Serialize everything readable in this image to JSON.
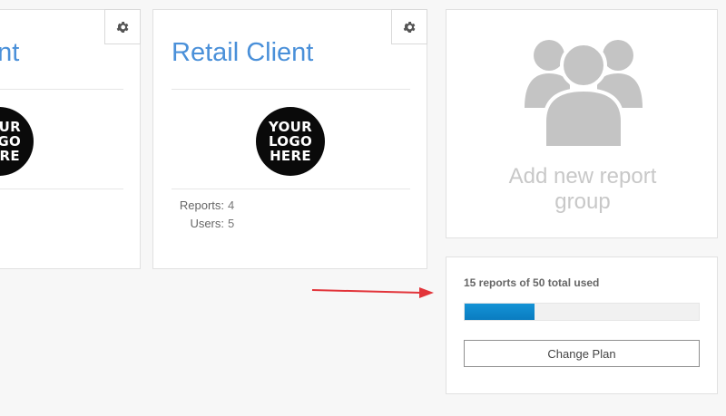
{
  "cards": [
    {
      "title": "ent",
      "logo_text": [
        "YOUR",
        "LOGO",
        "HERE"
      ]
    },
    {
      "title": "Retail Client",
      "logo_text": [
        "YOUR",
        "LOGO",
        "HERE"
      ],
      "stats": [
        {
          "label": "Reports:",
          "value": "4"
        },
        {
          "label": "Users:",
          "value": "5"
        }
      ]
    }
  ],
  "add_group": {
    "label": "Add new report group",
    "icon": "users-group-icon"
  },
  "usage": {
    "label": "15 reports of 50 total used",
    "used": 15,
    "total": 50,
    "button_label": "Change Plan"
  },
  "annotation": {
    "icon": "red-arrow-icon"
  },
  "colors": {
    "title": "#4a90d9",
    "progress": "#0a7cc0",
    "arrow": "#e2343a",
    "placeholder_icon": "#c4c4c4"
  }
}
